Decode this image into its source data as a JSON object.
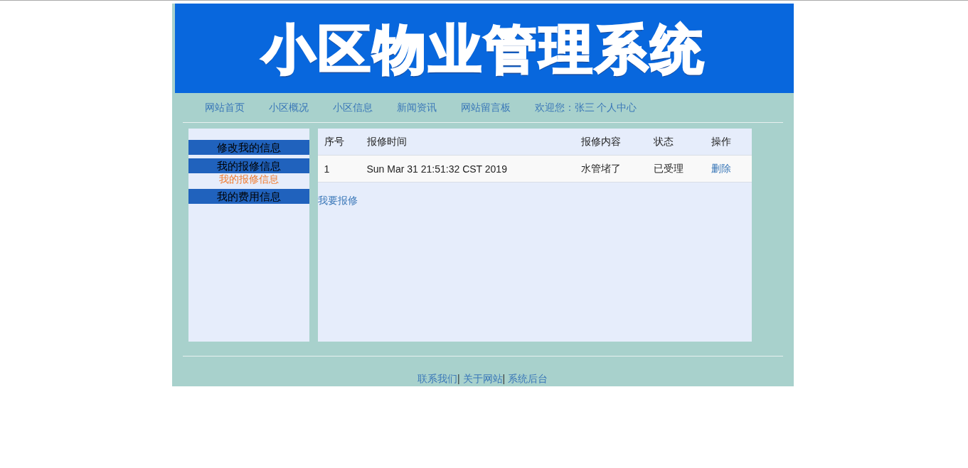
{
  "banner": {
    "title": "小区物业管理系统"
  },
  "nav": [
    {
      "label": "网站首页"
    },
    {
      "label": "小区概况"
    },
    {
      "label": "小区信息"
    },
    {
      "label": "新闻资讯"
    },
    {
      "label": "网站留言板"
    },
    {
      "label": "欢迎您：张三 个人中心"
    }
  ],
  "sidebar": {
    "groups": [
      {
        "title": "修改我的信息"
      },
      {
        "title": "我的报修信息",
        "links": [
          {
            "label": "我的报修信息",
            "selected": true
          }
        ]
      },
      {
        "title": "我的费用信息"
      }
    ]
  },
  "table": {
    "columns": [
      "序号",
      "报修时间",
      "报修内容",
      "状态",
      "操作"
    ],
    "rows": [
      {
        "cells": [
          "1",
          "Sun Mar 31 21:51:32 CST 2019",
          "水管堵了",
          "已受理"
        ],
        "action": "删除"
      }
    ]
  },
  "add_link": "我要报修",
  "footer": {
    "links": [
      "联系我们",
      "关于网站",
      "系统后台"
    ],
    "separator": "|"
  }
}
